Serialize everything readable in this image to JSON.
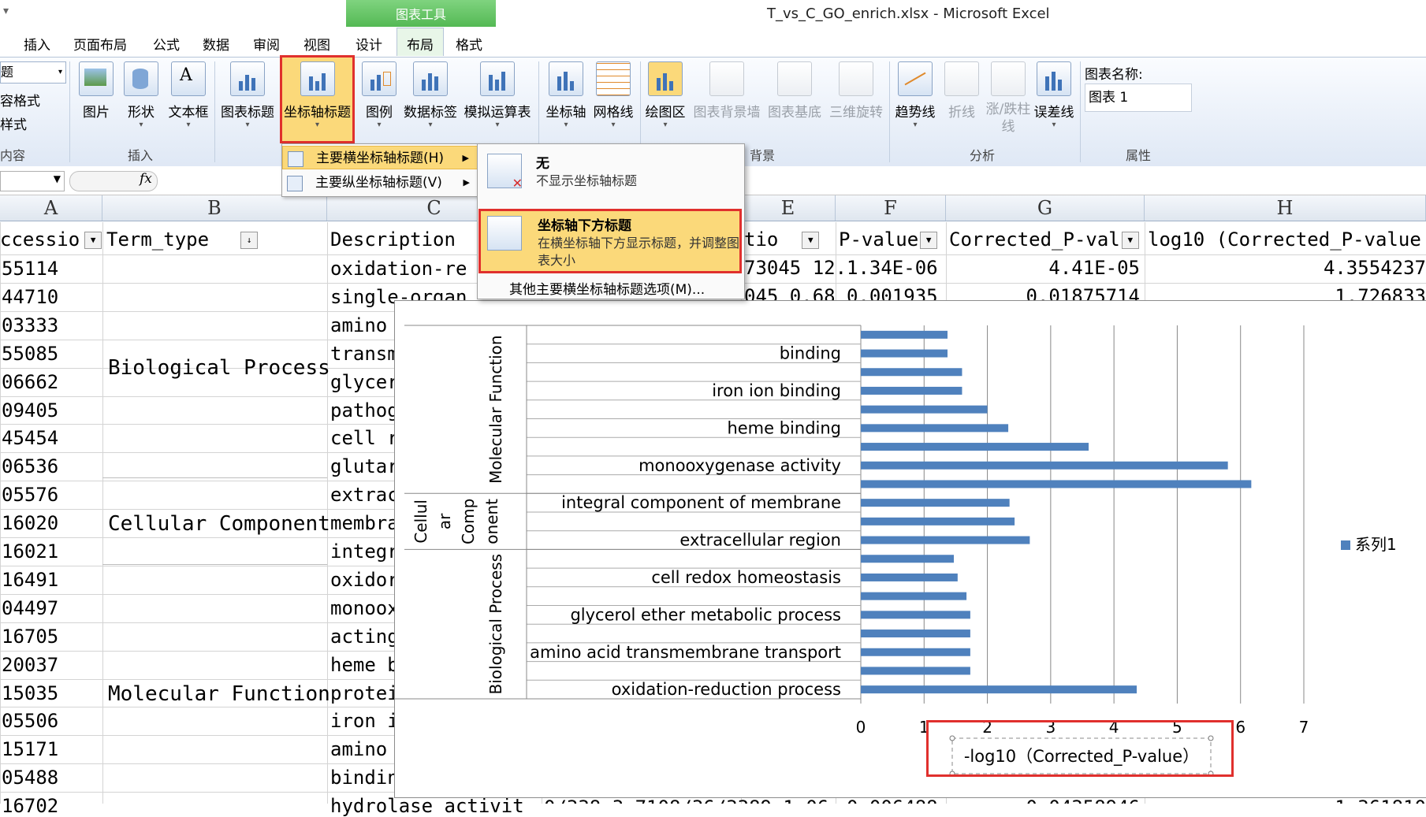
{
  "window": {
    "title": "T_vs_C_GO_enrich.xlsx - Microsoft Excel",
    "context_tab": "图表工具"
  },
  "tabs": [
    "插入",
    "页面布局",
    "公式",
    "数据",
    "审阅",
    "视图",
    "设计",
    "布局",
    "格式"
  ],
  "active_tab": "布局",
  "ribbon": {
    "left_partial": [
      "题",
      "容格式",
      "样式"
    ],
    "left_partial_group": "内容",
    "insert_group": {
      "label": "插入",
      "buttons": [
        "图片",
        "形状",
        "文本框"
      ]
    },
    "labels_group": {
      "buttons": [
        "图表标题",
        "坐标轴标题",
        "图例",
        "数据标签",
        "模拟运算表"
      ]
    },
    "axes_group": {
      "buttons": [
        "坐标轴",
        "网格线"
      ]
    },
    "background_group": {
      "label": "背景",
      "buttons": [
        "绘图区",
        "图表背景墙",
        "图表基底",
        "三维旋转"
      ]
    },
    "analysis_group": {
      "label": "分析",
      "buttons": [
        "趋势线",
        "折线",
        "涨/跌柱线",
        "误差线"
      ]
    },
    "properties_group": {
      "label": "属性",
      "name_label": "图表名称:",
      "name_value": "图表 1"
    }
  },
  "formula_bar": {
    "fx": "fx"
  },
  "menus": {
    "axis_title_menu": [
      {
        "label": "主要横坐标轴标题(H)"
      },
      {
        "label": "主要纵坐标轴标题(V)"
      }
    ],
    "submenu": {
      "none_title": "无",
      "none_desc": "不显示坐标轴标题",
      "below_title": "坐标轴下方标题",
      "below_desc": "在横坐标轴下方显示标题，并调整图表大小",
      "more": "其他主要横坐标轴标题选项(M)..."
    }
  },
  "sheet": {
    "columns": [
      "A",
      "B",
      "C",
      "E",
      "F",
      "G",
      "H"
    ],
    "headers": {
      "A": "ccessio",
      "B": "Term_type",
      "C": "Description",
      "E": "tio",
      "F": "P-value",
      "G": "Corrected_P-val",
      "H": "log10 (Corrected_P-value"
    },
    "col_a": [
      "55114",
      "44710",
      "03333",
      "55085",
      "06662",
      "09405",
      "45454",
      "06536",
      "05576",
      "16020",
      "16021",
      "16491",
      "04497",
      "16705",
      "20037",
      "15035",
      "05506",
      "15171",
      "05488",
      "16702"
    ],
    "col_c": [
      "oxidation-re",
      "single-organ",
      "amino",
      "transm",
      "glycer",
      "pathog",
      "cell r",
      "glutar",
      "extrac",
      "membra",
      "integr",
      "oxidor",
      "monoox",
      "acting",
      "heme b",
      "protei",
      "iron i",
      "amino",
      "bindin",
      "hydrolase activit"
    ],
    "row1": {
      "e": "73045 12.",
      "f": "1.34E-06",
      "g": "4.41E-05",
      "h": "4.3554237"
    },
    "row2": {
      "e": "045 0.68",
      "f": "0.001935",
      "g": "0.01875714",
      "h": "1.726833"
    },
    "row_last": {
      "e": "0/338 3.7108/36/3389 1.06",
      "f": "0.006488",
      "g": "0.04358946",
      "h": "1.361810"
    },
    "groups": [
      "Biological Process",
      "Cellular Component",
      "Molecular Function"
    ]
  },
  "chart_data": {
    "type": "bar",
    "orientation": "horizontal",
    "categories": [
      "oxidation-reduction process",
      "",
      "amino acid transmembrane transport",
      "",
      "glycerol ether metabolic process",
      "",
      "cell redox homeostasis",
      "",
      "extracellular region",
      "",
      "integral component of membrane",
      "",
      "monooxygenase activity",
      "",
      "heme binding",
      "",
      "iron ion binding",
      "",
      "binding",
      ""
    ],
    "group_labels": [
      "Biological Process",
      "Cellul ar Comp onent",
      "Molecular Function"
    ],
    "series": [
      {
        "name": "系列1",
        "values": [
          4.36,
          1.73,
          1.73,
          1.73,
          1.73,
          1.67,
          1.53,
          1.47,
          2.67,
          2.43,
          2.35,
          6.17,
          5.8,
          3.6,
          2.33,
          2.0,
          1.6,
          1.6,
          1.37,
          1.37
        ]
      }
    ],
    "xlim": [
      0,
      7
    ],
    "xticks": [
      0,
      1,
      2,
      3,
      4,
      5,
      6,
      7
    ],
    "xlabel": "-log10（Corrected_P-value）",
    "legend": "right",
    "grid": true,
    "bar_color": "#4f81bd"
  }
}
